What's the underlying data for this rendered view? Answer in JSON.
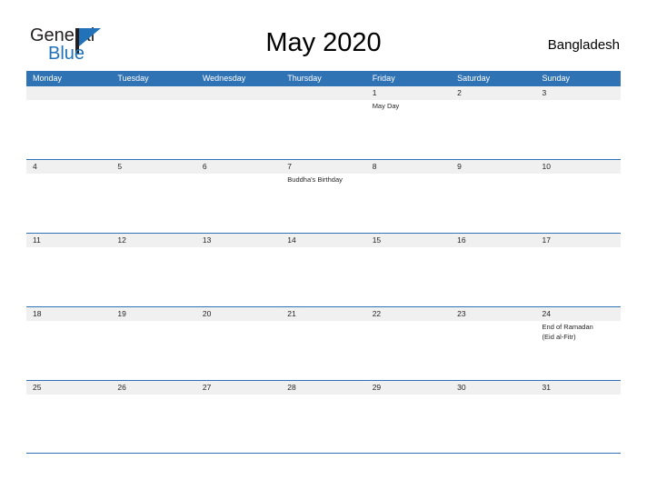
{
  "brand": {
    "name_part1": "General",
    "name_part2": "Blue",
    "flag_icon": "triangle-flag-icon",
    "accent_color": "#2172b8"
  },
  "header": {
    "title": "May 2020",
    "region": "Bangladesh"
  },
  "colors": {
    "header_blue": "#3073b4",
    "number_band_gray": "#f0f0f0",
    "text": "#231f20"
  },
  "calendar": {
    "weekdays": [
      "Monday",
      "Tuesday",
      "Wednesday",
      "Thursday",
      "Friday",
      "Saturday",
      "Sunday"
    ],
    "weeks": [
      {
        "days": [
          {
            "number": "",
            "event": ""
          },
          {
            "number": "",
            "event": ""
          },
          {
            "number": "",
            "event": ""
          },
          {
            "number": "",
            "event": ""
          },
          {
            "number": "1",
            "event": "May Day"
          },
          {
            "number": "2",
            "event": ""
          },
          {
            "number": "3",
            "event": ""
          }
        ]
      },
      {
        "days": [
          {
            "number": "4",
            "event": ""
          },
          {
            "number": "5",
            "event": ""
          },
          {
            "number": "6",
            "event": ""
          },
          {
            "number": "7",
            "event": "Buddha's Birthday"
          },
          {
            "number": "8",
            "event": ""
          },
          {
            "number": "9",
            "event": ""
          },
          {
            "number": "10",
            "event": ""
          }
        ]
      },
      {
        "days": [
          {
            "number": "11",
            "event": ""
          },
          {
            "number": "12",
            "event": ""
          },
          {
            "number": "13",
            "event": ""
          },
          {
            "number": "14",
            "event": ""
          },
          {
            "number": "15",
            "event": ""
          },
          {
            "number": "16",
            "event": ""
          },
          {
            "number": "17",
            "event": ""
          }
        ]
      },
      {
        "days": [
          {
            "number": "18",
            "event": ""
          },
          {
            "number": "19",
            "event": ""
          },
          {
            "number": "20",
            "event": ""
          },
          {
            "number": "21",
            "event": ""
          },
          {
            "number": "22",
            "event": ""
          },
          {
            "number": "23",
            "event": ""
          },
          {
            "number": "24",
            "event": "End of Ramadan\n(Eid al-Fitr)"
          }
        ]
      },
      {
        "days": [
          {
            "number": "25",
            "event": ""
          },
          {
            "number": "26",
            "event": ""
          },
          {
            "number": "27",
            "event": ""
          },
          {
            "number": "28",
            "event": ""
          },
          {
            "number": "29",
            "event": ""
          },
          {
            "number": "30",
            "event": ""
          },
          {
            "number": "31",
            "event": ""
          }
        ]
      }
    ]
  }
}
